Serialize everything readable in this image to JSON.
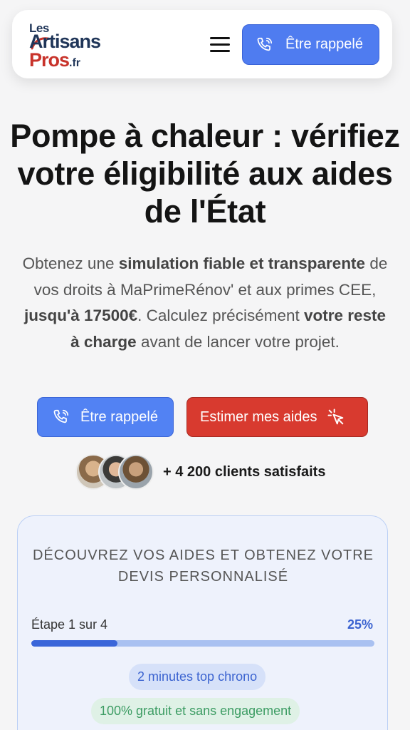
{
  "header": {
    "logo": {
      "line1": "Les",
      "line2": "Artisans",
      "line3": "Pros",
      "suffix": ".fr"
    },
    "menu_icon": "hamburger-icon",
    "call_button_label": "Être rappelé",
    "call_icon": "phone-icon"
  },
  "hero": {
    "title": "Pompe à chaleur : vérifiez votre éligibilité aux aides de l'État",
    "text_parts": {
      "p1": "Obtenez une ",
      "b1": "simulation fiable et transparente",
      "p2": " de vos droits à MaPrimeRénov' et aux primes CEE, ",
      "b2": "jusqu'à 17500€",
      "p3": ". Calculez précisément ",
      "b3": "votre reste à charge",
      "p4": " avant de lancer votre projet."
    },
    "call_button_label": "Être rappelé",
    "estimate_button_label": "Estimer mes aides",
    "estimate_icon": "cursor-click-icon",
    "clients_text": "+ 4 200 clients satisfaits"
  },
  "card": {
    "title": "DÉCOUVREZ VOS AIDES ET OBTENEZ VOTRE DEVIS PERSONNALISÉ",
    "step_label": "Étape 1 sur 4",
    "step_percent": "25%",
    "progress_fraction": 0.25,
    "chip_chrono": "2 minutes top chrono",
    "chip_free": "100% gratuit et sans engagement"
  },
  "colors": {
    "primary_blue": "#4f7cf0",
    "accent_red": "#d83a2f",
    "brand_navy": "#1f3558",
    "brand_red": "#c8332b",
    "success_green": "#3c9c63"
  }
}
